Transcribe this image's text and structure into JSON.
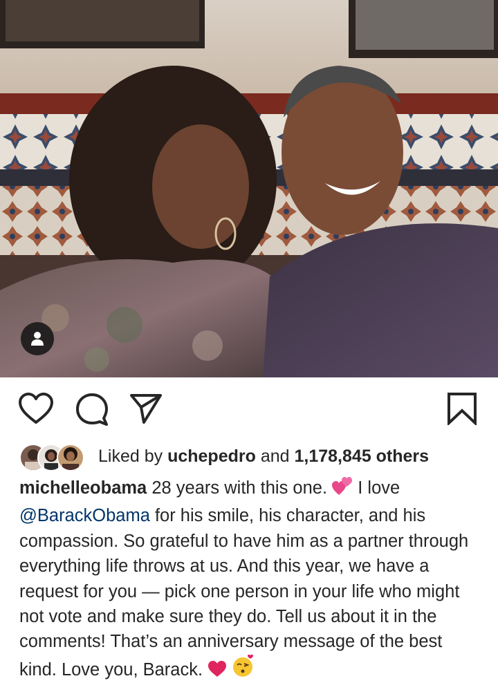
{
  "post": {
    "image_alt": "Couple selfie",
    "liked_by_label": "Liked by",
    "liked_by_user": "uchepedro",
    "likes_and": "and",
    "likes_count": "1,178,845 others",
    "caption_user": "michelleobama",
    "caption_part1": "28 years with this one.",
    "caption_part2": "I love",
    "caption_mention": "@BarackObama",
    "caption_part3": "for his smile, his character, and his compassion. So grateful to have him as a partner through everything life throws at us. And this year, we have a request for you — pick one person in your life who might not vote and make sure they do. Tell us about it in the comments! That’s an anniversary message of the best kind. Love you, Barack."
  },
  "icons": {
    "like": "heart-icon",
    "comment": "comment-icon",
    "share": "send-icon",
    "save": "bookmark-icon",
    "tags": "user-tag-icon",
    "emoji_1": "two-hearts-emoji",
    "emoji_2": "red-heart-emoji",
    "emoji_3": "kissing-face-emoji"
  },
  "colors": {
    "text": "#262626",
    "mention": "#003569",
    "heart_pink": "#e8488a",
    "heart_red": "#e0245e"
  }
}
